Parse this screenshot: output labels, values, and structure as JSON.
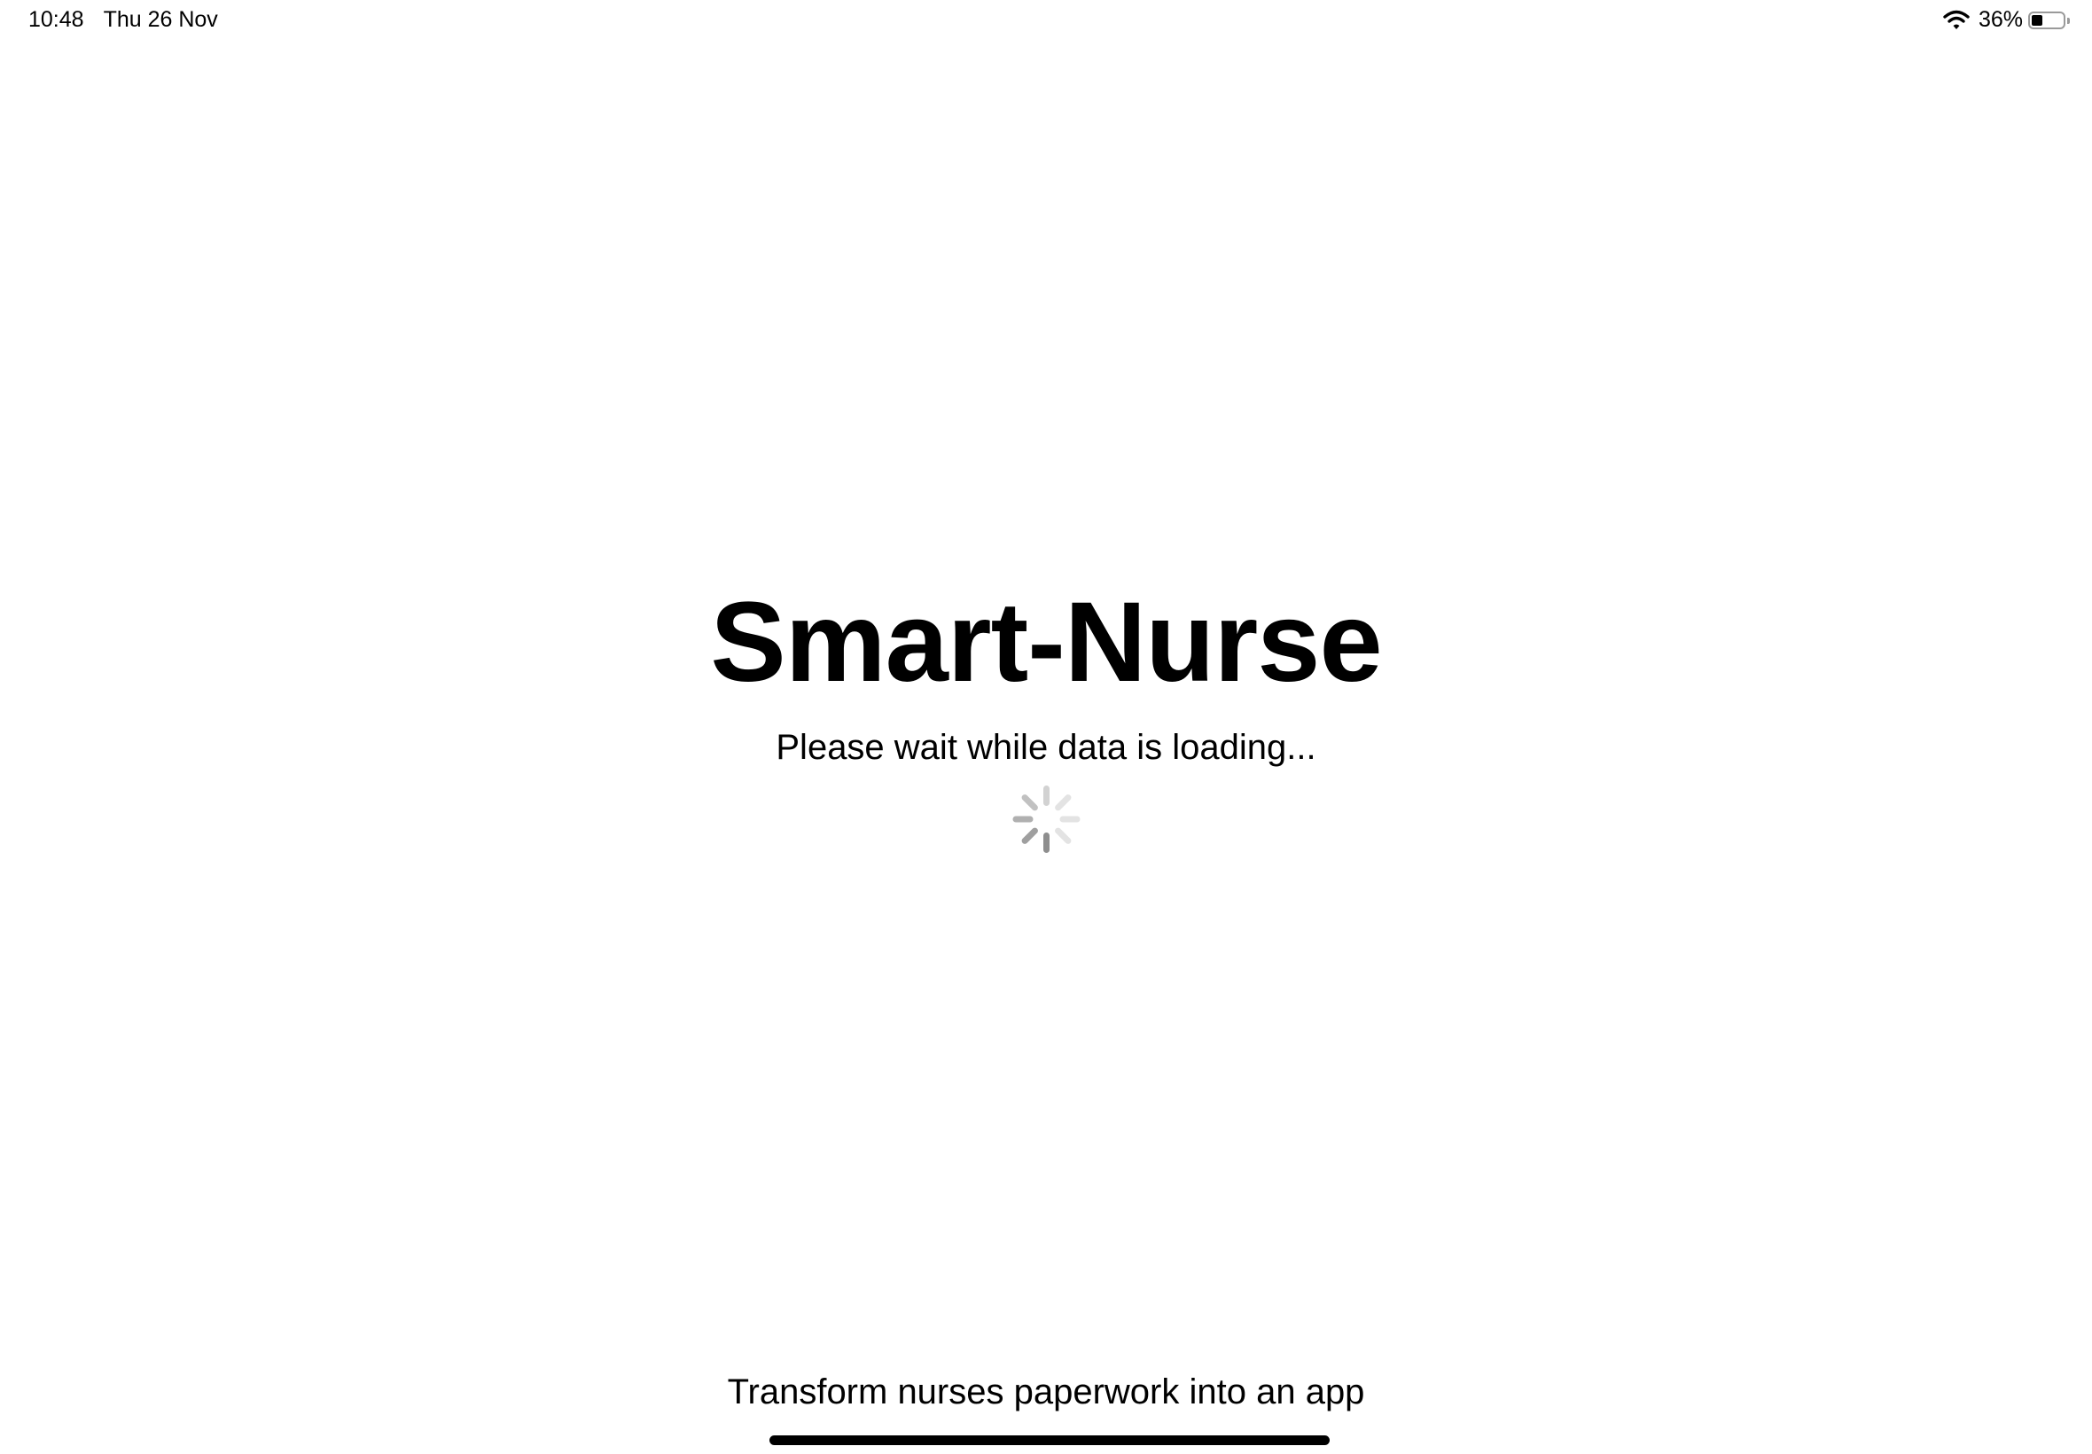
{
  "status_bar": {
    "time": "10:48",
    "date": "Thu 26 Nov",
    "battery_percent_label": "36%",
    "battery_level": 0.36,
    "icons": [
      "wifi-icon",
      "battery-icon"
    ]
  },
  "main": {
    "title": "Smart-Nurse",
    "loading_message": "Please wait while data is loading...",
    "spinner_icon": "activity-spinner-icon"
  },
  "footer": {
    "tagline": "Transform nurses paperwork into an app"
  },
  "colors": {
    "background": "#ffffff",
    "text": "#000000",
    "spinner_dark": "#8e8e8e",
    "spinner_light": "#e3e3e3"
  }
}
